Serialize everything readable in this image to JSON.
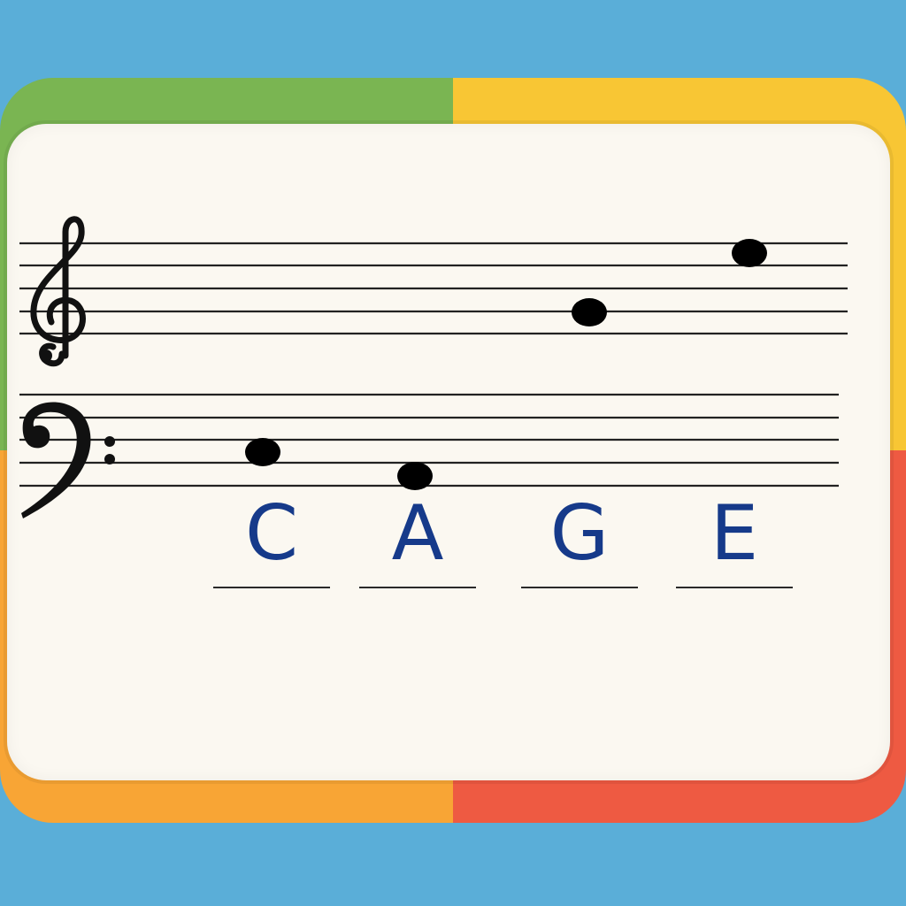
{
  "colors": {
    "background": "#5aaed8",
    "frame_top_left": "#7ab552",
    "frame_top_right": "#f8c634",
    "frame_bottom_left": "#f8a535",
    "frame_bottom_right": "#ee5a42",
    "card": "#fbf8f1",
    "answer_text": "#163a8a",
    "notes": "#000000"
  },
  "clefs": [
    "treble-clef-icon",
    "bass-clef-icon"
  ],
  "notes": [
    {
      "staff": "bass",
      "pitch": "C",
      "order": 1
    },
    {
      "staff": "bass",
      "pitch": "A",
      "order": 2
    },
    {
      "staff": "treble",
      "pitch": "G",
      "order": 3
    },
    {
      "staff": "treble",
      "pitch": "E",
      "order": 4
    }
  ],
  "answers": [
    "C",
    "A",
    "G",
    "E"
  ]
}
